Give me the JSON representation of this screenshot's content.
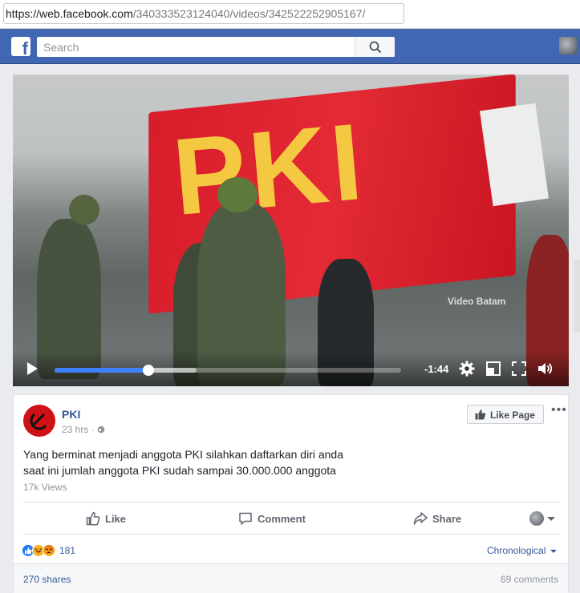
{
  "browser": {
    "url_scheme_host": "https://web.facebook.com",
    "url_path": "/340333523124040/videos/342522252905167/"
  },
  "header": {
    "logo": "f",
    "search_placeholder": "Search",
    "search_icon": "search-icon"
  },
  "video": {
    "flag_text": "PKI",
    "watermark": "Video Batam",
    "time_remaining": "-1:44",
    "progress_fraction": 0.27,
    "buffered_fraction": 0.41,
    "icons": [
      "play-icon",
      "gear-icon",
      "minimize-icon",
      "fullscreen-icon",
      "volume-icon"
    ]
  },
  "post": {
    "page_name": "PKI",
    "time": "23 hrs",
    "privacy_icon": "globe-icon",
    "like_page_label": "Like Page",
    "more_label": "•••",
    "text_line1": "Yang berminat menjadi anggota PKI silahkan daftarkan diri anda",
    "text_line2": "saat ini jumlah anggota PKI sudah sampai 30.000.000 anggota",
    "views": "17k Views",
    "actions": {
      "like": "Like",
      "comment": "Comment",
      "share": "Share"
    },
    "reaction_count": "181",
    "reactions": [
      "like",
      "haha",
      "angry"
    ],
    "sort_label": "Chronological",
    "shares": "270 shares",
    "comments": "69 comments"
  },
  "colors": {
    "fb_blue": "#4267b2",
    "link_blue": "#365899",
    "progress_blue": "#4080ff",
    "flag_red": "#d81c2a",
    "flag_yellow": "#f5c842"
  }
}
